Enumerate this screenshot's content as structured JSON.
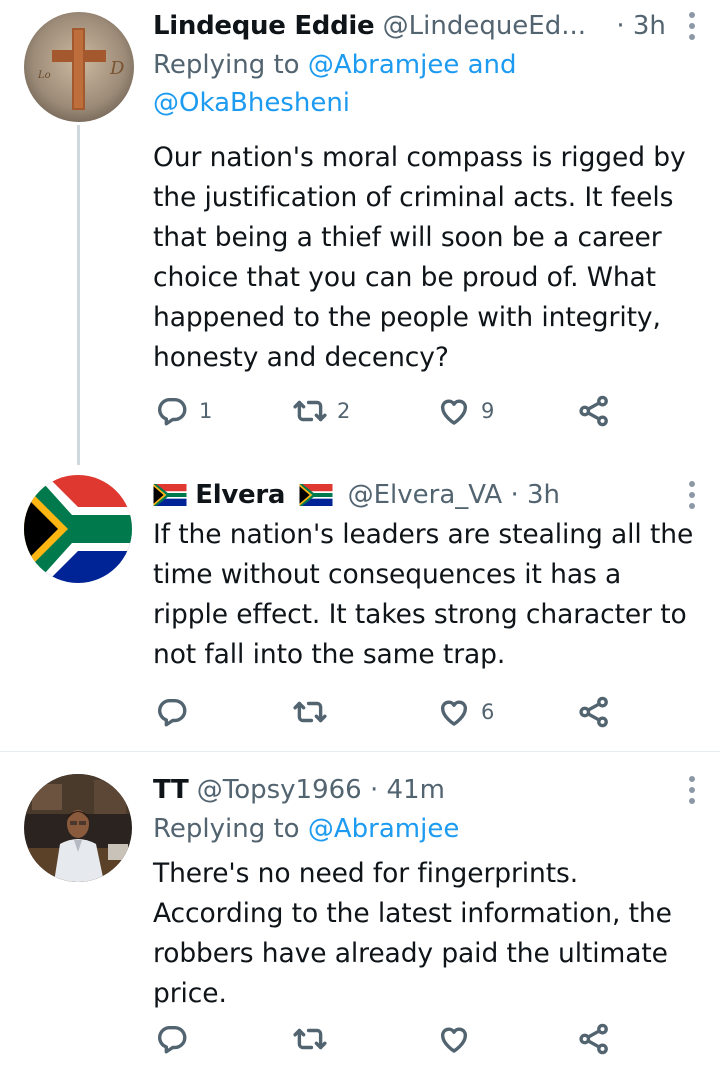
{
  "tweets": [
    {
      "name": "Lindeque Eddie",
      "handle": "@LindequeEd...",
      "dot": "·",
      "time": "3h",
      "replying_prefix": "Replying to",
      "replying_to_1": "@Abramjee",
      "replying_and": "and",
      "replying_to_2": "@OkaBhesheni",
      "text": "Our nation's moral compass is rigged by the justification of criminal acts. It feels that being a thief will soon be a career choice that you can be proud of. What happened to the people with integrity, honesty and decency?",
      "replies": "1",
      "retweets": "2",
      "likes": "9"
    },
    {
      "name": "Elvera",
      "handle": "@Elvera_VA",
      "dot": "·",
      "time": "3h",
      "text": "If the nation's leaders are stealing all the time without consequences it has a ripple effect. It takes strong character to not fall into the same trap.",
      "likes": "6"
    },
    {
      "name": "TT",
      "handle": "@Topsy1966",
      "dot": "·",
      "time": "41m",
      "replying_prefix": "Replying to",
      "replying_to_1": "@Abramjee",
      "text": "There's no need for fingerprints. According to the latest information, the robbers have already paid the ultimate price."
    }
  ],
  "icons": [
    "reply-icon",
    "retweet-icon",
    "like-icon",
    "share-icon",
    "more-icon",
    "south-africa-flag-icon"
  ],
  "colors": {
    "link": "#1d9bf0",
    "secondary": "#536471",
    "thread_line": "#cfd9de"
  }
}
